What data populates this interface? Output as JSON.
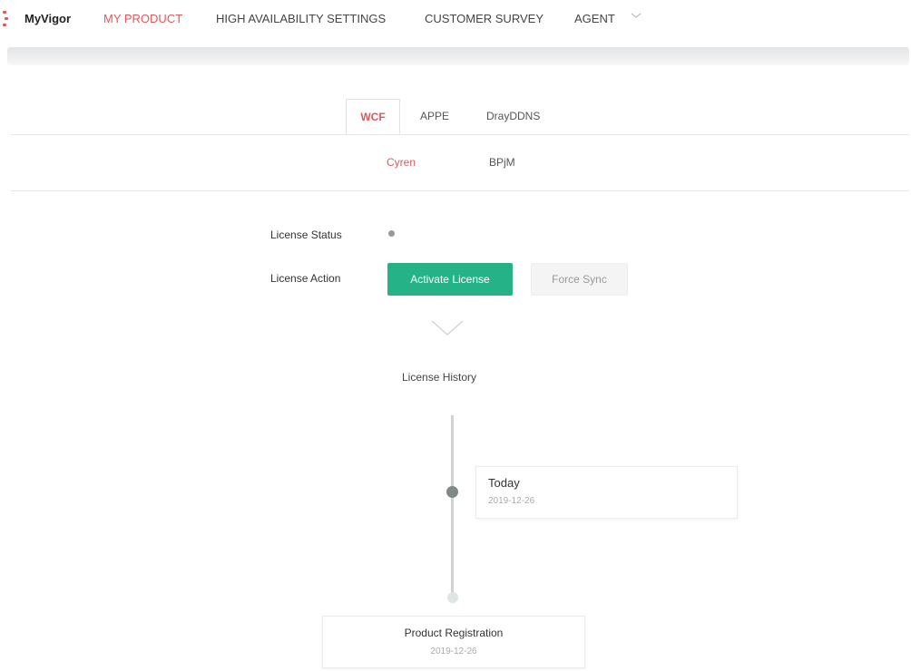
{
  "nav": {
    "brand": "MyVigor",
    "items": [
      {
        "label": "MY PRODUCT",
        "active": true
      },
      {
        "label": "HIGH AVAILABILITY SETTINGS",
        "active": false
      },
      {
        "label": "CUSTOMER SURVEY",
        "active": false
      },
      {
        "label": "AGENT",
        "active": false
      }
    ],
    "agent_dropdown_icon": "chevron-down-icon"
  },
  "tabs": [
    {
      "label": "WCF",
      "active": true
    },
    {
      "label": "APPE",
      "active": false
    },
    {
      "label": "DrayDDNS",
      "active": false
    }
  ],
  "subtabs": [
    {
      "label": "Cyren",
      "active": true
    },
    {
      "label": "BPjM",
      "active": false
    }
  ],
  "license": {
    "status_label": "License Status",
    "status_color": "#999999",
    "action_label": "License Action",
    "activate_button": "Activate License",
    "force_sync_button": "Force Sync",
    "expand_icon": "chevron-down-icon",
    "history_title": "License History"
  },
  "history": [
    {
      "title": "Today",
      "date": "2019-12-26"
    },
    {
      "title": "Product Registration",
      "date": "2019-12-26"
    }
  ],
  "colors": {
    "accent": "#e0585e",
    "primary_button": "#25b287",
    "timeline_dot_active": "#7f8a86",
    "timeline_dot_inactive": "#e0e4e2"
  }
}
